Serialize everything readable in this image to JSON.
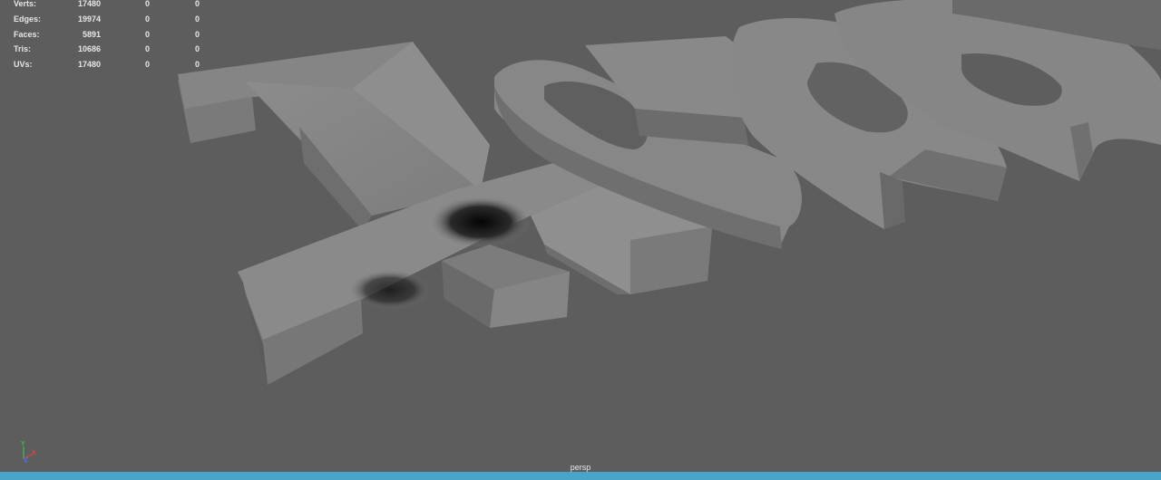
{
  "poly_count": {
    "rows": [
      {
        "label": "Verts:",
        "v1": "17480",
        "v2": "0",
        "v3": "0"
      },
      {
        "label": "Edges:",
        "v1": "19974",
        "v2": "0",
        "v3": "0"
      },
      {
        "label": "Faces:",
        "v1": "5891",
        "v2": "0",
        "v3": "0"
      },
      {
        "label": "Tris:",
        "v1": "10686",
        "v2": "0",
        "v3": "0"
      },
      {
        "label": "UVs:",
        "v1": "17480",
        "v2": "0",
        "v3": "0"
      }
    ]
  },
  "viewport": {
    "camera": "persp",
    "background_color": "#5d5d5d",
    "accent_bar_color": "#4aa3c9"
  },
  "axis_gizmo": {
    "x": "X",
    "y": "Y",
    "z": "Z",
    "x_color": "#e0443a",
    "y_color": "#3fbf4a",
    "z_color": "#4a6ee0"
  }
}
